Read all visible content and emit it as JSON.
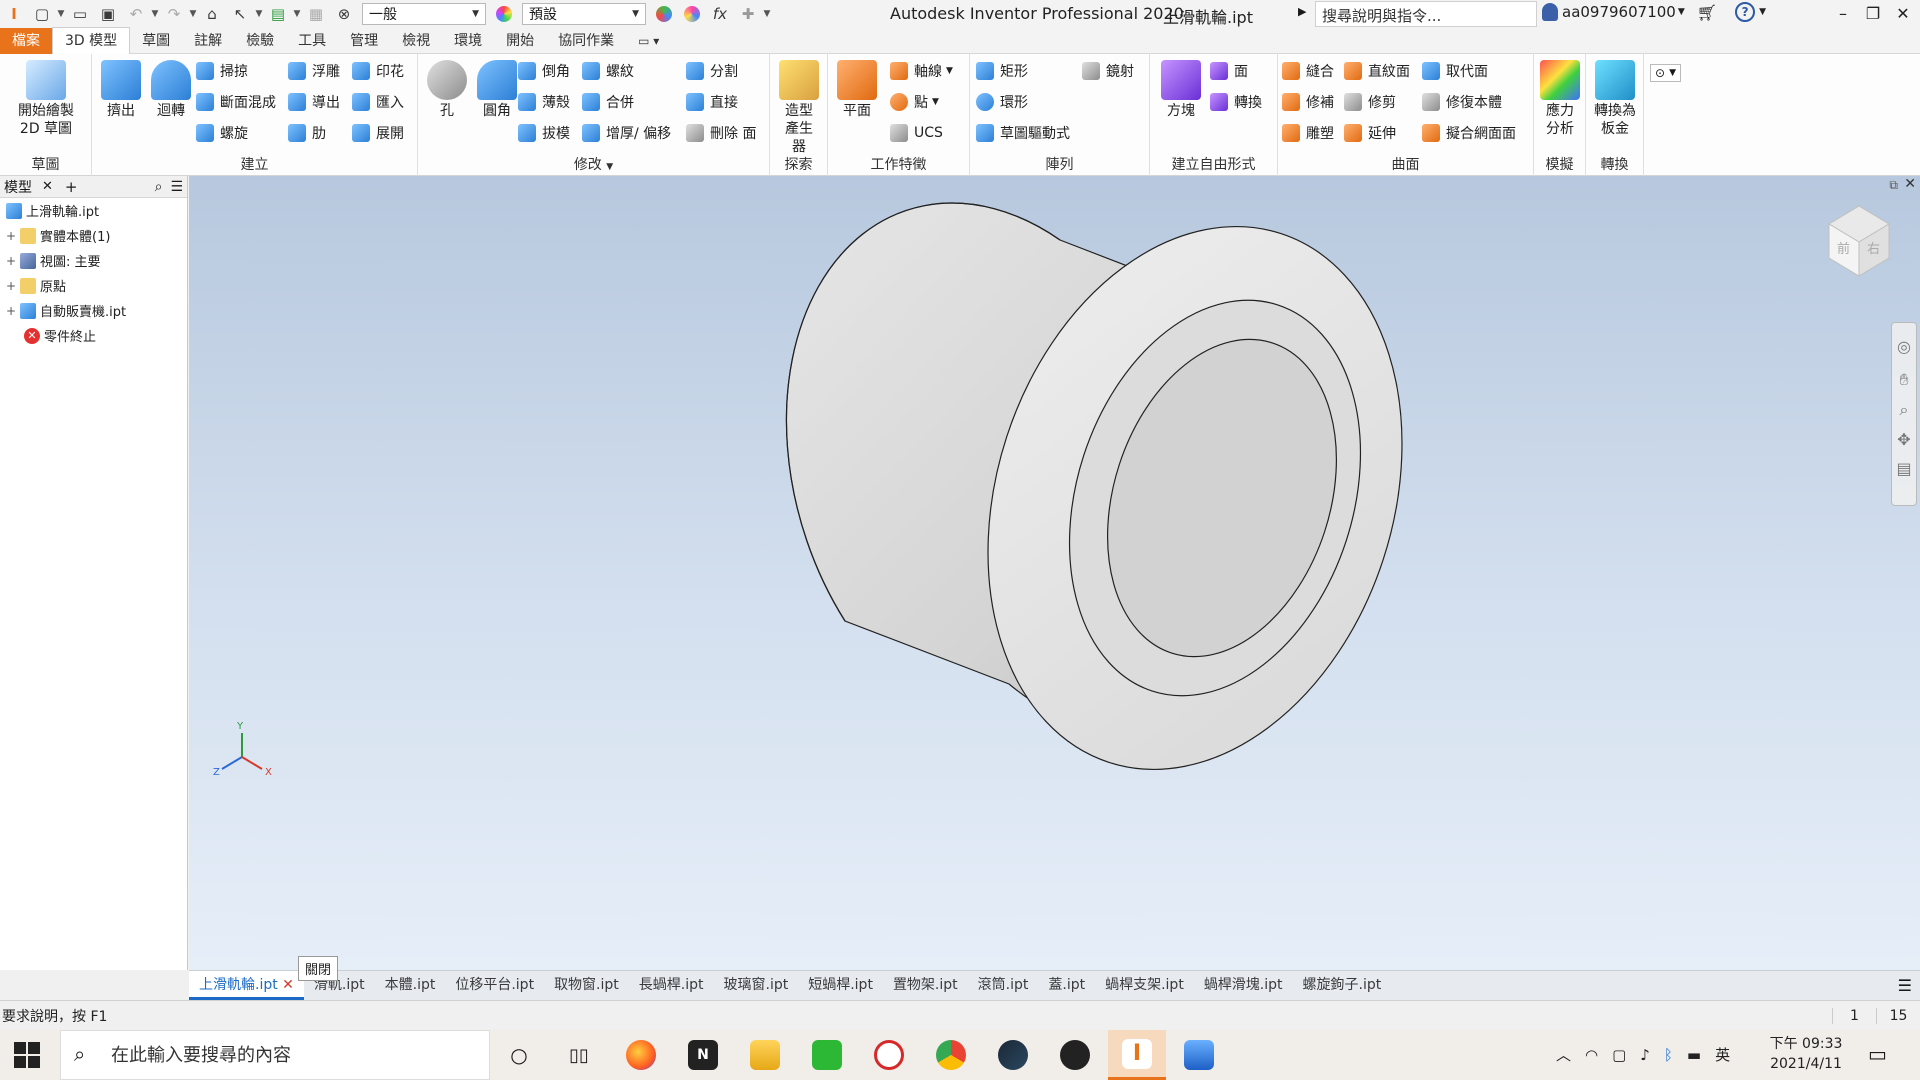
{
  "titlebar": {
    "style_combo": "一般",
    "appearance_combo": "預設",
    "app_title": "Autodesk Inventor Professional 2020",
    "file_title": "上滑軌輪.ipt",
    "search_placeholder": "搜尋說明與指令...",
    "user": "aa0979607100"
  },
  "menu": {
    "tabs": [
      {
        "label": "檔案"
      },
      {
        "label": "3D 模型"
      },
      {
        "label": "草圖"
      },
      {
        "label": "註解"
      },
      {
        "label": "檢驗"
      },
      {
        "label": "工具"
      },
      {
        "label": "管理"
      },
      {
        "label": "檢視"
      },
      {
        "label": "環境"
      },
      {
        "label": "開始"
      },
      {
        "label": "協同作業"
      }
    ]
  },
  "ribbon": {
    "sketch_panel": {
      "label": "草圖",
      "start_sketch": "開始繪製 2D 草圖"
    },
    "create_panel": {
      "label": "建立",
      "extrude": "擠出",
      "revolve": "迴轉",
      "sweep": "掃掠",
      "loft": "斷面混成",
      "coil": "螺旋",
      "emboss": "浮雕",
      "derive": "導出",
      "rib": "肋",
      "decal": "印花",
      "import": "匯入",
      "unfold": "展開"
    },
    "modify_panel": {
      "label": "修改",
      "hole": "孔",
      "fillet": "圓角",
      "chamfer": "倒角",
      "shell": "薄殼",
      "draft": "拔模",
      "thread": "螺紋",
      "combine": "合併",
      "thicken": "增厚/ 偏移",
      "split": "分割",
      "direct": "直接",
      "delete_face": "刪除 面"
    },
    "explore_panel": {
      "label": "探索",
      "shape_generator": "造型產生器"
    },
    "work_features_panel": {
      "label": "工作特徵",
      "plane": "平面",
      "axis": "軸線",
      "point": "點",
      "ucs": "UCS"
    },
    "pattern_panel": {
      "label": "陣列",
      "rectangular": "矩形",
      "circular": "環形",
      "sketch_driven": "草圖驅動式",
      "mirror": "鏡射"
    },
    "freeform_panel": {
      "label": "建立自由形式",
      "box": "方塊",
      "face": "面",
      "convert": "轉換"
    },
    "surface_panel": {
      "label": "曲面",
      "stitch": "縫合",
      "patch": "修補",
      "sculpt": "雕塑",
      "ruled": "直紋面",
      "trim": "修剪",
      "extend": "延伸",
      "replace_face": "取代面",
      "repair": "修復本體",
      "fit_mesh": "擬合網面面"
    },
    "simulation_panel": {
      "label": "模擬",
      "stress": "應力分析"
    },
    "convert_panel": {
      "label": "轉換",
      "sheet_metal": "轉換為板金"
    }
  },
  "browser": {
    "tab_label": "模型",
    "items": [
      {
        "label": "上滑軌輪.ipt"
      },
      {
        "label": "實體本體(1)"
      },
      {
        "label": "視圖: 主要"
      },
      {
        "label": "原點"
      },
      {
        "label": "自動販賣機.ipt"
      },
      {
        "label": "零件終止"
      }
    ]
  },
  "viewport": {
    "viewcube_faces": [
      "前",
      "右"
    ],
    "axes": [
      "Y",
      "Z",
      "X"
    ]
  },
  "doctabs": {
    "tooltip": "關閉",
    "tabs": [
      {
        "label": "上滑軌輪.ipt"
      },
      {
        "label": "滑軌.ipt"
      },
      {
        "label": "本體.ipt"
      },
      {
        "label": "位移平台.ipt"
      },
      {
        "label": "取物窗.ipt"
      },
      {
        "label": "長蝸桿.ipt"
      },
      {
        "label": "玻璃窗.ipt"
      },
      {
        "label": "短蝸桿.ipt"
      },
      {
        "label": "置物架.ipt"
      },
      {
        "label": "滾筒.ipt"
      },
      {
        "label": "蓋.ipt"
      },
      {
        "label": "蝸桿支架.ipt"
      },
      {
        "label": "蝸桿滑塊.ipt"
      },
      {
        "label": "螺旋鉤子.ipt"
      }
    ]
  },
  "status": {
    "help": "要求說明，按 F1",
    "count1": "1",
    "count2": "15"
  },
  "taskbar": {
    "search_placeholder": "在此輸入要搜尋的內容",
    "ime": "英",
    "time": "下午 09:33",
    "date": "2021/4/11"
  },
  "colors": {
    "accent": "#e8731a",
    "active_tab": "#1b6bc6"
  }
}
